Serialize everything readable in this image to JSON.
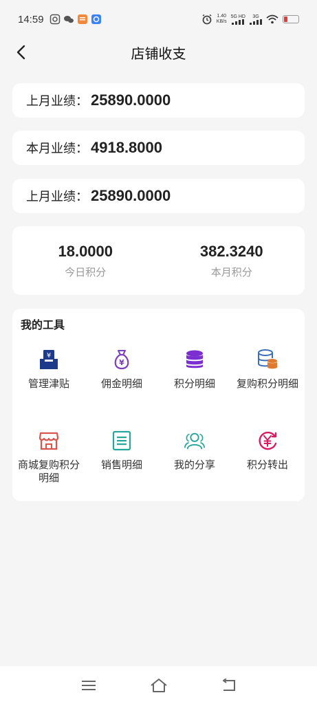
{
  "status_bar": {
    "time": "14:59",
    "net_speed_value": "1.40",
    "net_speed_unit": "KB/s",
    "signal1_label": "5G HD",
    "signal2_label": "3G"
  },
  "nav": {
    "title": "店铺收支",
    "back_icon": "chevron-left-icon"
  },
  "performance": [
    {
      "label": "上月业绩：",
      "value": "25890.0000"
    },
    {
      "label": "本月业绩：",
      "value": "4918.8000"
    },
    {
      "label": "上月业绩：",
      "value": "25890.0000"
    }
  ],
  "points": {
    "today_value": "18.0000",
    "today_label": "今日积分",
    "month_value": "382.3240",
    "month_label": "本月积分"
  },
  "tools": {
    "title": "我的工具",
    "items": [
      {
        "label": "管理津贴",
        "icon": "allowance-box-icon",
        "color": "#1e3a8a"
      },
      {
        "label": "佣金明细",
        "icon": "money-bag-icon",
        "color": "#7b3fbf"
      },
      {
        "label": "积分明细",
        "icon": "coin-stack-icon",
        "color": "#7b3fbf"
      },
      {
        "label": "复购积分明细",
        "icon": "database-coin-icon",
        "color": "#e07a2e"
      },
      {
        "label": "商城复购积分明细",
        "icon": "shop-icon",
        "color": "#d9534f"
      },
      {
        "label": "销售明细",
        "icon": "list-document-icon",
        "color": "#26a69a"
      },
      {
        "label": "我的分享",
        "icon": "share-people-icon",
        "color": "#26a69a"
      },
      {
        "label": "积分转出",
        "icon": "yen-transfer-icon",
        "color": "#d81b60"
      }
    ]
  },
  "bottom_nav": {
    "menu_icon": "menu-icon",
    "home_icon": "home-icon",
    "back_icon": "back-arrow-icon"
  },
  "colors": {
    "background": "#f5f5f5",
    "card": "#ffffff",
    "text_primary": "#222222",
    "text_secondary": "#999999",
    "battery_low": "#e53935"
  }
}
